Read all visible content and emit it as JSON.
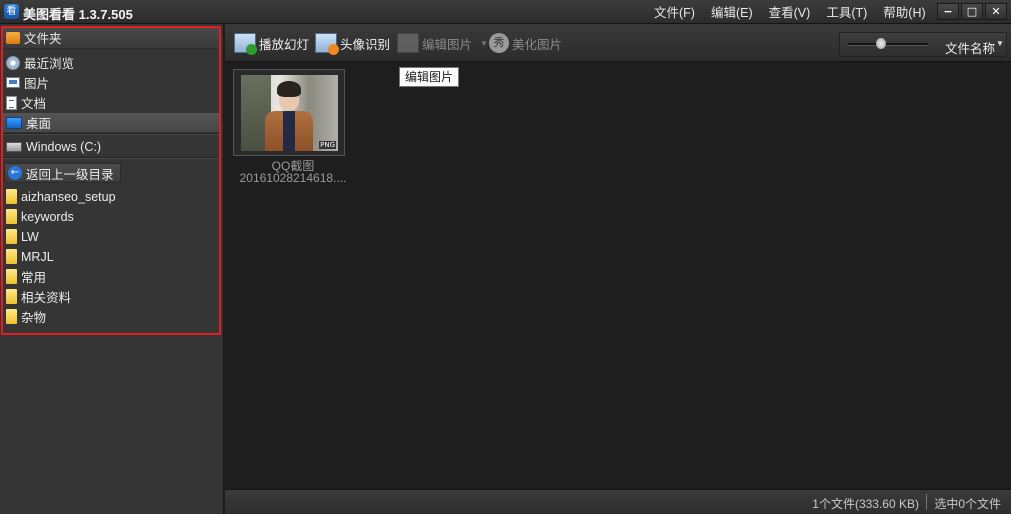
{
  "app": {
    "icon_glyph": "看",
    "title": "美图看看 1.3.7.505"
  },
  "menu": [
    {
      "label": "文件(F)"
    },
    {
      "label": "编辑(E)"
    },
    {
      "label": "查看(V)"
    },
    {
      "label": "工具(T)"
    },
    {
      "label": "帮助(H)"
    }
  ],
  "window_controls": {
    "minimize": "−",
    "maximize": "□",
    "close": "✕"
  },
  "sidebar": {
    "highlight_color": "#e02020",
    "header_label": "文件夹",
    "quick_items": [
      {
        "label": "最近浏览",
        "icon": "history-icon"
      },
      {
        "label": "图片",
        "icon": "pictures-icon"
      },
      {
        "label": "文档",
        "icon": "documents-icon"
      },
      {
        "label": "桌面",
        "icon": "desktop-icon",
        "selected": true
      }
    ],
    "drive_label": "Windows (C:)",
    "back_label": "返回上一级目录",
    "folders": [
      {
        "label": "aizhanseo_setup"
      },
      {
        "label": "keywords"
      },
      {
        "label": "LW"
      },
      {
        "label": "MRJL"
      },
      {
        "label": "常用"
      },
      {
        "label": "相关资料"
      },
      {
        "label": "杂物"
      }
    ]
  },
  "toolbar": {
    "slideshow_label": "播放幻灯",
    "face_recognition_label": "头像识别",
    "edit_label": "编辑图片",
    "edit_dropdown": "▼",
    "beautify_glyph": "秀",
    "beautify_label": "美化图片",
    "zoom_level": 0.4,
    "sort_label": "文件名称",
    "sort_arrow": "▼"
  },
  "tooltip": {
    "text": "编辑图片"
  },
  "files": [
    {
      "name": "QQ截图",
      "date_name": "20161028214618....",
      "badge": "PNG"
    }
  ],
  "status": {
    "count": "1个文件(333.60 KB)",
    "selected": "选中0个文件"
  }
}
